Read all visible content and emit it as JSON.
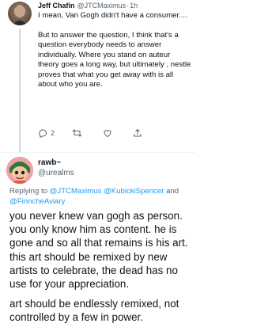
{
  "tweet1": {
    "name": "Jeff Chafin",
    "handle": "@JTCMaximus",
    "separator": "·",
    "time": "1h",
    "paragraphs": [
      "I mean, Van Gogh didn't have a consumer....",
      "But to answer the question, I think that's a question everybody needs to answer individually. Where you stand on auteur theory goes a long way, but ultimately , nestle proves that what you get away with is all about who you are."
    ],
    "actions": {
      "reply_count": "2",
      "retweet_count": "",
      "like_count": ""
    }
  },
  "tweet2": {
    "name": "rawb~",
    "handle": "@urealms",
    "replying_prefix": "Replying to",
    "mentions": [
      "@JTCMaximus",
      "@KubickiSpencer",
      "@FinncheAviary"
    ],
    "and_word": "and",
    "paragraphs": [
      "you never knew van gogh as person. you only know him as content. he is gone and so all that remains is his art. this art should be remixed by new artists to celebrate, the dead has no use for your appreciation.",
      "art should be endlessly remixed, not controlled by a few in power."
    ]
  },
  "colors": {
    "text": "#0f1419",
    "secondary": "#536471",
    "link": "#1d9bf0",
    "divider": "#eff3f4"
  }
}
